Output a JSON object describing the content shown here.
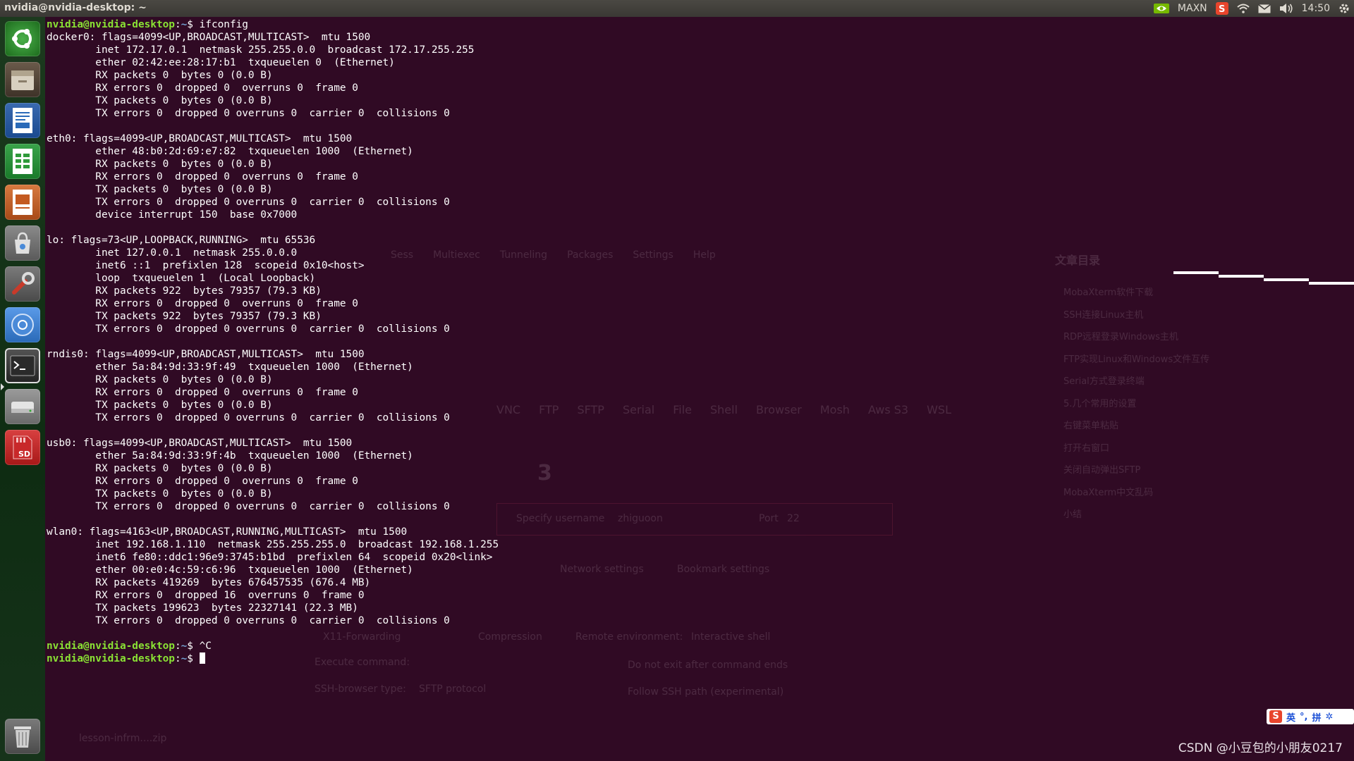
{
  "window_title": "nvidia@nvidia-desktop: ~",
  "tray": {
    "nvidia_label": "MAXN",
    "time": "14:50",
    "icons": [
      "nvidia-icon",
      "sogou-icon",
      "wifi-icon",
      "mail-icon",
      "volume-icon",
      "settings-gear-icon"
    ]
  },
  "launcher": {
    "items": [
      {
        "name": "ubuntu-dash-icon",
        "color": "#2a7a2a"
      },
      {
        "name": "file-manager-icon",
        "color": "#e8e0d0"
      },
      {
        "name": "libreoffice-writer-icon",
        "color": "#2a6ab8"
      },
      {
        "name": "libreoffice-calc-icon",
        "color": "#2e9a3a"
      },
      {
        "name": "libreoffice-impress-icon",
        "color": "#c45a20"
      },
      {
        "name": "software-center-icon",
        "color": "#d6d6d6"
      },
      {
        "name": "system-settings-icon",
        "color": "#c83a2a"
      },
      {
        "name": "chromium-icon",
        "color": "#4a8ad8"
      },
      {
        "name": "terminal-icon",
        "color": "#2a2a2a"
      },
      {
        "name": "drive-icon",
        "color": "#bdbdbd"
      },
      {
        "name": "sd-card-icon",
        "color": "#c8282a"
      },
      {
        "name": "trash-icon",
        "color": "#bdbdbd"
      }
    ],
    "sd_label": "SD"
  },
  "terminal": {
    "user_host": "nvidia@nvidia-desktop",
    "path": "~",
    "lines": [
      {
        "type": "prompt",
        "cmd": "ifconfig"
      },
      {
        "type": "text",
        "text": "docker0: flags=4099<UP,BROADCAST,MULTICAST>  mtu 1500"
      },
      {
        "type": "text",
        "text": "        inet 172.17.0.1  netmask 255.255.0.0  broadcast 172.17.255.255"
      },
      {
        "type": "text",
        "text": "        ether 02:42:ee:28:17:b1  txqueuelen 0  (Ethernet)"
      },
      {
        "type": "text",
        "text": "        RX packets 0  bytes 0 (0.0 B)"
      },
      {
        "type": "text",
        "text": "        RX errors 0  dropped 0  overruns 0  frame 0"
      },
      {
        "type": "text",
        "text": "        TX packets 0  bytes 0 (0.0 B)"
      },
      {
        "type": "text",
        "text": "        TX errors 0  dropped 0 overruns 0  carrier 0  collisions 0"
      },
      {
        "type": "text",
        "text": ""
      },
      {
        "type": "text",
        "text": "eth0: flags=4099<UP,BROADCAST,MULTICAST>  mtu 1500"
      },
      {
        "type": "text",
        "text": "        ether 48:b0:2d:69:e7:82  txqueuelen 1000  (Ethernet)"
      },
      {
        "type": "text",
        "text": "        RX packets 0  bytes 0 (0.0 B)"
      },
      {
        "type": "text",
        "text": "        RX errors 0  dropped 0  overruns 0  frame 0"
      },
      {
        "type": "text",
        "text": "        TX packets 0  bytes 0 (0.0 B)"
      },
      {
        "type": "text",
        "text": "        TX errors 0  dropped 0 overruns 0  carrier 0  collisions 0"
      },
      {
        "type": "text",
        "text": "        device interrupt 150  base 0x7000"
      },
      {
        "type": "text",
        "text": ""
      },
      {
        "type": "text",
        "text": "lo: flags=73<UP,LOOPBACK,RUNNING>  mtu 65536"
      },
      {
        "type": "text",
        "text": "        inet 127.0.0.1  netmask 255.0.0.0"
      },
      {
        "type": "text",
        "text": "        inet6 ::1  prefixlen 128  scopeid 0x10<host>"
      },
      {
        "type": "text",
        "text": "        loop  txqueuelen 1  (Local Loopback)"
      },
      {
        "type": "text",
        "text": "        RX packets 922  bytes 79357 (79.3 KB)"
      },
      {
        "type": "text",
        "text": "        RX errors 0  dropped 0  overruns 0  frame 0"
      },
      {
        "type": "text",
        "text": "        TX packets 922  bytes 79357 (79.3 KB)"
      },
      {
        "type": "text",
        "text": "        TX errors 0  dropped 0 overruns 0  carrier 0  collisions 0"
      },
      {
        "type": "text",
        "text": ""
      },
      {
        "type": "text",
        "text": "rndis0: flags=4099<UP,BROADCAST,MULTICAST>  mtu 1500"
      },
      {
        "type": "text",
        "text": "        ether 5a:84:9d:33:9f:49  txqueuelen 1000  (Ethernet)"
      },
      {
        "type": "text",
        "text": "        RX packets 0  bytes 0 (0.0 B)"
      },
      {
        "type": "text",
        "text": "        RX errors 0  dropped 0  overruns 0  frame 0"
      },
      {
        "type": "text",
        "text": "        TX packets 0  bytes 0 (0.0 B)"
      },
      {
        "type": "text",
        "text": "        TX errors 0  dropped 0 overruns 0  carrier 0  collisions 0"
      },
      {
        "type": "text",
        "text": ""
      },
      {
        "type": "text",
        "text": "usb0: flags=4099<UP,BROADCAST,MULTICAST>  mtu 1500"
      },
      {
        "type": "text",
        "text": "        ether 5a:84:9d:33:9f:4b  txqueuelen 1000  (Ethernet)"
      },
      {
        "type": "text",
        "text": "        RX packets 0  bytes 0 (0.0 B)"
      },
      {
        "type": "text",
        "text": "        RX errors 0  dropped 0  overruns 0  frame 0"
      },
      {
        "type": "text",
        "text": "        TX packets 0  bytes 0 (0.0 B)"
      },
      {
        "type": "text",
        "text": "        TX errors 0  dropped 0 overruns 0  carrier 0  collisions 0"
      },
      {
        "type": "text",
        "text": ""
      },
      {
        "type": "text",
        "text": "wlan0: flags=4163<UP,BROADCAST,RUNNING,MULTICAST>  mtu 1500"
      },
      {
        "type": "text",
        "text": "        inet 192.168.1.110  netmask 255.255.255.0  broadcast 192.168.1.255"
      },
      {
        "type": "text",
        "text": "        inet6 fe80::ddc1:96e9:3745:b1bd  prefixlen 64  scopeid 0x20<link>"
      },
      {
        "type": "text",
        "text": "        ether 00:e0:4c:59:c6:96  txqueuelen 1000  (Ethernet)"
      },
      {
        "type": "text",
        "text": "        RX packets 419269  bytes 676457535 (676.4 MB)"
      },
      {
        "type": "text",
        "text": "        RX errors 0  dropped 16  overruns 0  frame 0"
      },
      {
        "type": "text",
        "text": "        TX packets 199623  bytes 22327141 (22.3 MB)"
      },
      {
        "type": "text",
        "text": "        TX errors 0  dropped 0 overruns 0  carrier 0  collisions 0"
      },
      {
        "type": "text",
        "text": ""
      },
      {
        "type": "prompt",
        "cmd": "^C"
      },
      {
        "type": "prompt",
        "cmd": "",
        "cursor": true
      }
    ]
  },
  "background_ghost": {
    "toolbar_items": [
      "Sess",
      "Multiexec",
      "Tunneling",
      "Packages",
      "Settings",
      "Help"
    ],
    "session_types": [
      "VNC",
      "FTP",
      "SFTP",
      "Serial",
      "File",
      "Shell",
      "Browser",
      "Mosh",
      "Aws S3",
      "WSL"
    ],
    "step_number": "3",
    "specify_username": "Specify username",
    "username_value": "zhiguoon",
    "port_label": "Port",
    "port_value": "22",
    "network_settings": "Network settings",
    "bookmark_settings": "Bookmark settings",
    "x11_forwarding": "X11-Forwarding",
    "compression": "Compression",
    "remote_env_label": "Remote environment:",
    "remote_env_value": "Interactive shell",
    "execute_command": "Execute command:",
    "do_not_exit": "Do not exit after command ends",
    "ssh_browser_type": "SSH-browser type:",
    "ssh_browser_value": "SFTP protocol",
    "follow_ssh_path": "Follow SSH path (experimental)",
    "toc_title": "文章目录",
    "toc_items": [
      "MobaXterm软件下载",
      "SSH连接Linux主机",
      "RDP远程登录Windows主机",
      "FTP实现Linux和Windows文件互传",
      "Serial方式登录终端",
      "5.几个常用的设置",
      "右键菜单粘贴",
      "打开右窗口",
      "关闭自动弹出SFTP",
      "MobaXterm中文乱码",
      "小结"
    ],
    "bottom_file": "lesson-infrm....zip"
  },
  "ime_bar": {
    "lang": "英",
    "mode": "拼"
  },
  "watermark": "CSDN @小豆包的小朋友0217",
  "colors": {
    "terminal_bg": "#300a24",
    "prompt_green": "#8ae234",
    "path_blue": "#729fcf",
    "text": "#ffffff"
  }
}
